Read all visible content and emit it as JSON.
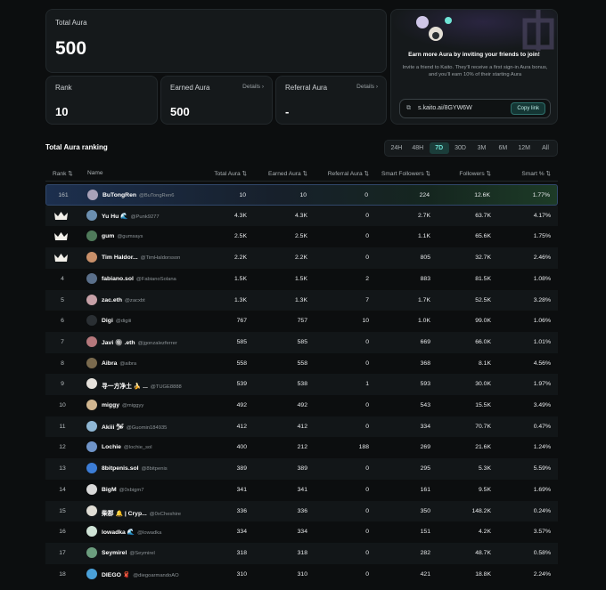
{
  "stats": {
    "total": {
      "label": "Total Aura",
      "value": "500"
    },
    "rank": {
      "label": "Rank",
      "value": "10"
    },
    "earned": {
      "label": "Earned Aura",
      "value": "500",
      "details": "Details ›"
    },
    "referral": {
      "label": "Referral Aura",
      "value": "-",
      "details": "Details ›"
    }
  },
  "invite": {
    "title": "Earn more Aura by inviting your friends to join!",
    "subtitle": "Invite a friend to Kaito. They'll receive a first sign-in Aura bonus, and you'll earn 10% of their starting Aura",
    "link": "s.kaito.ai/8GYW6W",
    "link_icon": "link-icon",
    "copy_label": "Copy link"
  },
  "ranking": {
    "title": "Total Aura ranking",
    "periods": [
      "24H",
      "48H",
      "7D",
      "30D",
      "3M",
      "6M",
      "12M",
      "All"
    ],
    "active_period": "7D",
    "columns": {
      "rank": "Rank ⇅",
      "name": "Name",
      "total": "Total Aura ⇅",
      "earned": "Earned Aura ⇅",
      "referral": "Referral Aura ⇅",
      "smart": "Smart Followers ⇅",
      "followers": "Followers ⇅",
      "pct": "Smart % ⇅"
    },
    "rows": [
      {
        "rank": "161",
        "crown": false,
        "name": "BuTongRen",
        "handle": "@BuTongRen6",
        "total": "10",
        "earned": "10",
        "referral": "0",
        "smart": "224",
        "followers": "12.6K",
        "pct": "1.77%",
        "avatar_color": "#a9a2b8",
        "me": true
      },
      {
        "rank": "",
        "crown": true,
        "name": "Yu Hu 🌊",
        "handle": "@Punk9277",
        "total": "4.3K",
        "earned": "4.3K",
        "referral": "0",
        "smart": "2.7K",
        "followers": "63.7K",
        "pct": "4.17%",
        "avatar_color": "#6b8fb0"
      },
      {
        "rank": "",
        "crown": true,
        "name": "gum",
        "handle": "@gumsays",
        "total": "2.5K",
        "earned": "2.5K",
        "referral": "0",
        "smart": "1.1K",
        "followers": "65.6K",
        "pct": "1.75%",
        "avatar_color": "#4f7a5a"
      },
      {
        "rank": "",
        "crown": true,
        "name": "Tim Haldor...",
        "handle": "@TimHaldorsson",
        "total": "2.2K",
        "earned": "2.2K",
        "referral": "0",
        "smart": "805",
        "followers": "32.7K",
        "pct": "2.46%",
        "avatar_color": "#c9906a"
      },
      {
        "rank": "4",
        "crown": false,
        "name": "fabiano.sol",
        "handle": "@FabianoSolana",
        "total": "1.5K",
        "earned": "1.5K",
        "referral": "2",
        "smart": "883",
        "followers": "81.5K",
        "pct": "1.08%",
        "avatar_color": "#5a6f8a"
      },
      {
        "rank": "5",
        "crown": false,
        "name": "zac.eth",
        "handle": "@zacxbt",
        "total": "1.3K",
        "earned": "1.3K",
        "referral": "7",
        "smart": "1.7K",
        "followers": "52.5K",
        "pct": "3.28%",
        "avatar_color": "#c7a1a8"
      },
      {
        "rank": "6",
        "crown": false,
        "name": "Digi",
        "handle": "@digiii",
        "total": "767",
        "earned": "757",
        "referral": "10",
        "smart": "1.0K",
        "followers": "99.0K",
        "pct": "1.06%",
        "avatar_color": "#2a2f33"
      },
      {
        "rank": "7",
        "crown": false,
        "name": "Javi 🔘 .eth",
        "handle": "@jgonzalezferrer",
        "total": "585",
        "earned": "585",
        "referral": "0",
        "smart": "669",
        "followers": "66.0K",
        "pct": "1.01%",
        "avatar_color": "#b5787c"
      },
      {
        "rank": "8",
        "crown": false,
        "name": "Aibra",
        "handle": "@aibra",
        "total": "558",
        "earned": "558",
        "referral": "0",
        "smart": "368",
        "followers": "8.1K",
        "pct": "4.56%",
        "avatar_color": "#7a6a4e"
      },
      {
        "rank": "9",
        "crown": false,
        "name": "寻一方净土 🍌 ...",
        "handle": "@TUGE8888",
        "total": "539",
        "earned": "538",
        "referral": "1",
        "smart": "593",
        "followers": "30.0K",
        "pct": "1.97%",
        "avatar_color": "#e6e2dc"
      },
      {
        "rank": "10",
        "crown": false,
        "name": "miggy",
        "handle": "@miggyy",
        "total": "492",
        "earned": "492",
        "referral": "0",
        "smart": "543",
        "followers": "15.5K",
        "pct": "3.49%",
        "avatar_color": "#d1b690"
      },
      {
        "rank": "11",
        "crown": false,
        "name": "Akiii 🛩",
        "handle": "@Guomin184935",
        "total": "412",
        "earned": "412",
        "referral": "0",
        "smart": "334",
        "followers": "70.7K",
        "pct": "0.47%",
        "avatar_color": "#8fb7d4"
      },
      {
        "rank": "12",
        "crown": false,
        "name": "Lochie",
        "handle": "@lochie_sol",
        "total": "400",
        "earned": "212",
        "referral": "188",
        "smart": "269",
        "followers": "21.6K",
        "pct": "1.24%",
        "avatar_color": "#6f94c8"
      },
      {
        "rank": "13",
        "crown": false,
        "name": "8bitpenis.sol",
        "handle": "@8bitpenis",
        "total": "389",
        "earned": "389",
        "referral": "0",
        "smart": "295",
        "followers": "5.3K",
        "pct": "5.59%",
        "avatar_color": "#3c7dd6"
      },
      {
        "rank": "14",
        "crown": false,
        "name": "BigM",
        "handle": "@0xbigm7",
        "total": "341",
        "earned": "341",
        "referral": "0",
        "smart": "161",
        "followers": "9.5K",
        "pct": "1.69%",
        "avatar_color": "#d9d9d9"
      },
      {
        "rank": "15",
        "crown": false,
        "name": "柴郡 🔔 | Cryp...",
        "handle": "@0xCheshire",
        "total": "336",
        "earned": "336",
        "referral": "0",
        "smart": "350",
        "followers": "148.2K",
        "pct": "0.24%",
        "avatar_color": "#e0ddd5"
      },
      {
        "rank": "16",
        "crown": false,
        "name": "lowadka 🌊",
        "handle": "@lowadka",
        "total": "334",
        "earned": "334",
        "referral": "0",
        "smart": "151",
        "followers": "4.2K",
        "pct": "3.57%",
        "avatar_color": "#cfe3d6"
      },
      {
        "rank": "17",
        "crown": false,
        "name": "Seymirel",
        "handle": "@Seymirel",
        "total": "318",
        "earned": "318",
        "referral": "0",
        "smart": "282",
        "followers": "48.7K",
        "pct": "0.58%",
        "avatar_color": "#6b9d7e"
      },
      {
        "rank": "18",
        "crown": false,
        "name": "DIEGO 🧣",
        "handle": "@diegoarmandoAO",
        "total": "310",
        "earned": "310",
        "referral": "0",
        "smart": "421",
        "followers": "18.8K",
        "pct": "2.24%",
        "avatar_color": "#4aa0d8"
      }
    ]
  }
}
